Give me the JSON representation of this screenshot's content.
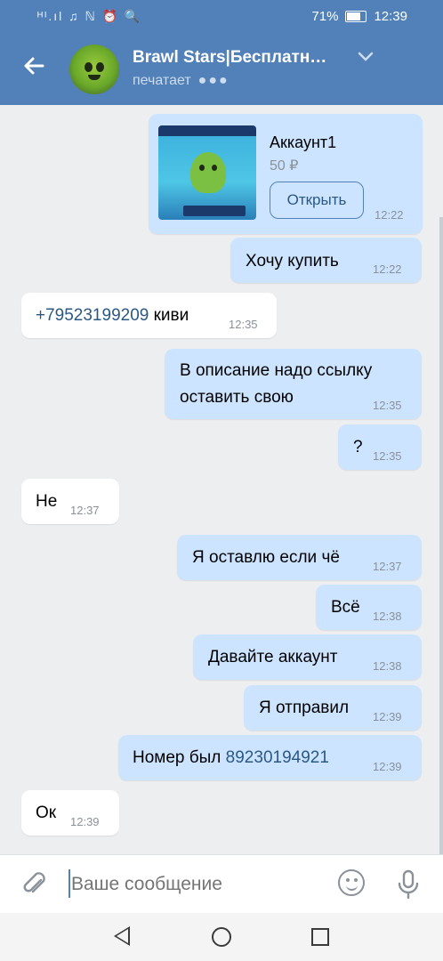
{
  "status_bar": {
    "left_icons": "ᴴᴵ.ıl ♫ ℕ ⏰ 🔍",
    "battery_text": "71%",
    "time": "12:39"
  },
  "header": {
    "back_icon": "arrow-left",
    "title": "Brawl Stars|Бесплатн…",
    "status": "печатает",
    "typing_dots": "●●●",
    "chevron": "⌄"
  },
  "product_card": {
    "title": "Аккаунт1",
    "price": "50 ₽",
    "button_label": "Открыть",
    "time": "12:22"
  },
  "messages": [
    {
      "dir": "out",
      "text": "Хочу купить",
      "time": "12:22"
    },
    {
      "dir": "in",
      "phone": "+79523199209",
      "text": " киви",
      "time": "12:35"
    },
    {
      "dir": "out",
      "line1": "В описание надо ссылку",
      "line2": "оставить свою",
      "time": "12:35"
    },
    {
      "dir": "out",
      "text": "?",
      "time": "12:35"
    },
    {
      "dir": "in",
      "text": "Не",
      "time": "12:37"
    },
    {
      "dir": "out",
      "text": "Я оставлю если чё",
      "time": "12:37"
    },
    {
      "dir": "out",
      "text": "Всё",
      "time": "12:38"
    },
    {
      "dir": "out",
      "text": "Давайте аккаунт",
      "time": "12:38"
    },
    {
      "dir": "out",
      "text": "Я отправил",
      "time": "12:39"
    },
    {
      "dir": "out",
      "text": "Номер был ",
      "phone": "89230194921",
      "time": "12:39"
    },
    {
      "dir": "in",
      "text": "Ок",
      "time": "12:39"
    }
  ],
  "composer": {
    "placeholder": "Ваше сообщение",
    "attach_icon": "paperclip",
    "emoji_icon": "smile",
    "mic_icon": "microphone"
  },
  "colors": {
    "header": "#5181b8",
    "outgoing_bubble": "#cce4ff",
    "incoming_bubble": "#ffffff",
    "background": "#edeef0",
    "link": "#2a5885"
  }
}
